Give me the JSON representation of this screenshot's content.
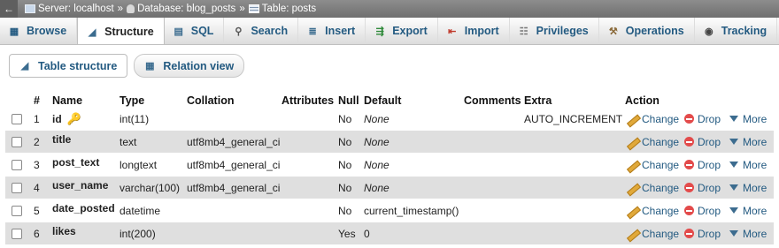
{
  "breadcrumb": {
    "server_label": "Server: localhost",
    "database_label": "Database: blog_posts",
    "table_label": "Table: posts",
    "separator": "»"
  },
  "tabs": [
    {
      "label": "Browse",
      "icon": "browse-icon",
      "active": false
    },
    {
      "label": "Structure",
      "icon": "structure-icon",
      "active": true
    },
    {
      "label": "SQL",
      "icon": "sql-icon",
      "active": false
    },
    {
      "label": "Search",
      "icon": "search-icon",
      "active": false
    },
    {
      "label": "Insert",
      "icon": "insert-icon",
      "active": false
    },
    {
      "label": "Export",
      "icon": "export-icon",
      "active": false
    },
    {
      "label": "Import",
      "icon": "import-icon",
      "active": false
    },
    {
      "label": "Privileges",
      "icon": "privileges-icon",
      "active": false
    },
    {
      "label": "Operations",
      "icon": "operations-icon",
      "active": false
    },
    {
      "label": "Tracking",
      "icon": "tracking-icon",
      "active": false
    }
  ],
  "subtabs": {
    "table_structure": "Table structure",
    "relation_view": "Relation view"
  },
  "columns": {
    "num": "#",
    "name": "Name",
    "type": "Type",
    "collation": "Collation",
    "attributes": "Attributes",
    "null": "Null",
    "default": "Default",
    "comments": "Comments",
    "extra": "Extra",
    "action": "Action"
  },
  "actions": {
    "change": "Change",
    "drop": "Drop",
    "more": "More"
  },
  "rows": [
    {
      "num": "1",
      "name": "id",
      "type": "int(11)",
      "collation": "",
      "attributes": "",
      "null": "No",
      "default": "None",
      "comments": "",
      "extra": "AUTO_INCREMENT",
      "primary_key": true
    },
    {
      "num": "2",
      "name": "title",
      "type": "text",
      "collation": "utf8mb4_general_ci",
      "attributes": "",
      "null": "No",
      "default": "None",
      "comments": "",
      "extra": ""
    },
    {
      "num": "3",
      "name": "post_text",
      "type": "longtext",
      "collation": "utf8mb4_general_ci",
      "attributes": "",
      "null": "No",
      "default": "None",
      "comments": "",
      "extra": ""
    },
    {
      "num": "4",
      "name": "user_name",
      "type": "varchar(100)",
      "collation": "utf8mb4_general_ci",
      "attributes": "",
      "null": "No",
      "default": "None",
      "comments": "",
      "extra": ""
    },
    {
      "num": "5",
      "name": "date_posted",
      "type": "datetime",
      "collation": "",
      "attributes": "",
      "null": "No",
      "default": "current_timestamp()",
      "comments": "",
      "extra": ""
    },
    {
      "num": "6",
      "name": "likes",
      "type": "int(200)",
      "collation": "",
      "attributes": "",
      "null": "Yes",
      "default": "0",
      "comments": "",
      "extra": ""
    }
  ],
  "colors": {
    "link": "#235a81",
    "row_shade": "#dfdfdf",
    "drop_red": "#e34b4b",
    "key_gold": "#d8a200"
  }
}
